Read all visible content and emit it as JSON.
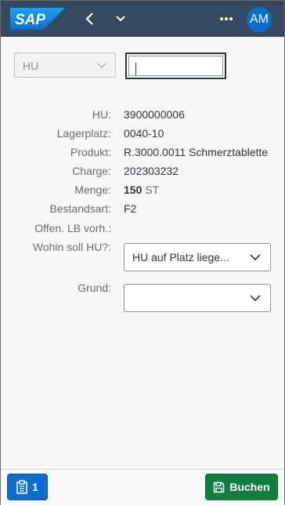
{
  "header": {
    "logo_text": "SAP",
    "avatar_initials": "AM",
    "icons": [
      "sap-logo",
      "chevron-left-icon",
      "chevron-down-icon",
      "more-icon"
    ]
  },
  "top": {
    "hu_select_value": "HU",
    "scan_input_value": ""
  },
  "form": {
    "hu": {
      "label": "HU:",
      "value": "3900000006"
    },
    "lagerplatz": {
      "label": "Lagerplatz:",
      "value": "0040-10"
    },
    "produkt": {
      "label": "Produkt:",
      "value": "R.3000.0011 Schmerztablette"
    },
    "charge": {
      "label": "Charge:",
      "value": "202303232"
    },
    "menge": {
      "label": "Menge:",
      "value": "150",
      "unit": "ST"
    },
    "bestandsart": {
      "label": "Bestandsart:",
      "value": "F2"
    },
    "offen_lb": {
      "label": "Offen. LB vorh.:",
      "value": ""
    },
    "wohin": {
      "label": "Wohin soll HU?:",
      "value": "HU auf Platz liege..."
    },
    "grund": {
      "label": "Grund:",
      "value": ""
    }
  },
  "footer": {
    "queue_count": "1",
    "book_label": "Buchen"
  },
  "colors": {
    "shellbar": "#354a5f",
    "avatar": "#0a6ed1",
    "queue_button": "#0a6ed1",
    "book_button": "#107e3e"
  }
}
